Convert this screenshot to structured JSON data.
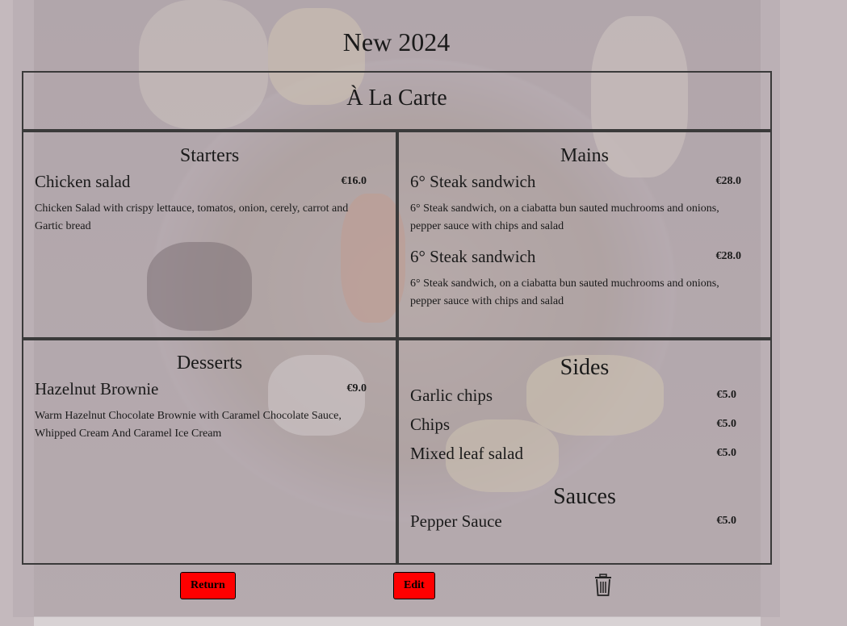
{
  "page": {
    "title": "New 2024"
  },
  "menu": {
    "header": "À La Carte",
    "starters": {
      "title": "Starters",
      "items": [
        {
          "name": "Chicken salad",
          "price": "€16.0",
          "desc": "Chicken Salad with crispy lettauce, tomatos, onion, cerely, carrot and Gartic bread"
        }
      ]
    },
    "mains": {
      "title": "Mains",
      "items": [
        {
          "name": "6° Steak sandwich",
          "price": "€28.0",
          "desc": "6° Steak sandwich, on a ciabatta bun sauted muchrooms and onions, pepper sauce with chips and salad"
        },
        {
          "name": "6° Steak sandwich",
          "price": "€28.0",
          "desc": "6° Steak sandwich, on a ciabatta bun sauted muchrooms and onions, pepper sauce with chips and salad"
        }
      ]
    },
    "desserts": {
      "title": "Desserts",
      "items": [
        {
          "name": "Hazelnut Brownie",
          "price": "€9.0",
          "desc": "Warm Hazelnut Chocolate Brownie with Caramel Chocolate Sauce, Whipped Cream And Caramel Ice Cream"
        }
      ]
    },
    "sides": {
      "title": "Sides",
      "items": [
        {
          "name": "Garlic chips",
          "price": "€5.0"
        },
        {
          "name": "Chips",
          "price": "€5.0"
        },
        {
          "name": "Mixed leaf salad",
          "price": "€5.0"
        }
      ]
    },
    "sauces": {
      "title": "Sauces",
      "items": [
        {
          "name": "Pepper Sauce",
          "price": "€5.0"
        }
      ]
    }
  },
  "actions": {
    "return_label": "Return",
    "edit_label": "Edit",
    "delete_icon": "trash-icon"
  },
  "colors": {
    "button_bg": "#ff0000",
    "overlay": "#b4aaae"
  }
}
